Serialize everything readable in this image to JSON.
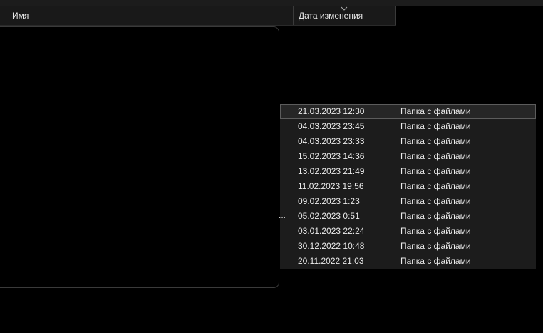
{
  "header": {
    "name_label": "Имя",
    "date_label": "Дата изменения",
    "sort_icon": "chevron-down-icon"
  },
  "rows": [
    {
      "date": "21.03.2023 12:30",
      "type": "Папка с файлами",
      "selected": true
    },
    {
      "date": "04.03.2023 23:45",
      "type": "Папка с файлами"
    },
    {
      "date": "04.03.2023 23:33",
      "type": "Папка с файлами"
    },
    {
      "date": "15.02.2023 14:36",
      "type": "Папка с файлами"
    },
    {
      "date": "13.02.2023 21:49",
      "type": "Папка с файлами"
    },
    {
      "date": "11.02.2023 19:56",
      "type": "Папка с файлами"
    },
    {
      "date": "09.02.2023 1:23",
      "type": "Папка с файлами"
    },
    {
      "date": "05.02.2023 0:51",
      "type": "Папка с файлами"
    },
    {
      "date": "03.01.2023 22:24",
      "type": "Папка с файлами"
    },
    {
      "date": "30.12.2022 10:48",
      "type": "Папка с файлами"
    },
    {
      "date": "20.11.2022 21:03",
      "type": "Папка с файлами"
    }
  ],
  "overflow_text": "...",
  "colors": {
    "background": "#000000",
    "header_bg": "#191919",
    "row_bg": "#1c1c1c",
    "selected_row_bg": "#262626",
    "selected_outline": "#5c5c5c",
    "text": "#ececec"
  }
}
